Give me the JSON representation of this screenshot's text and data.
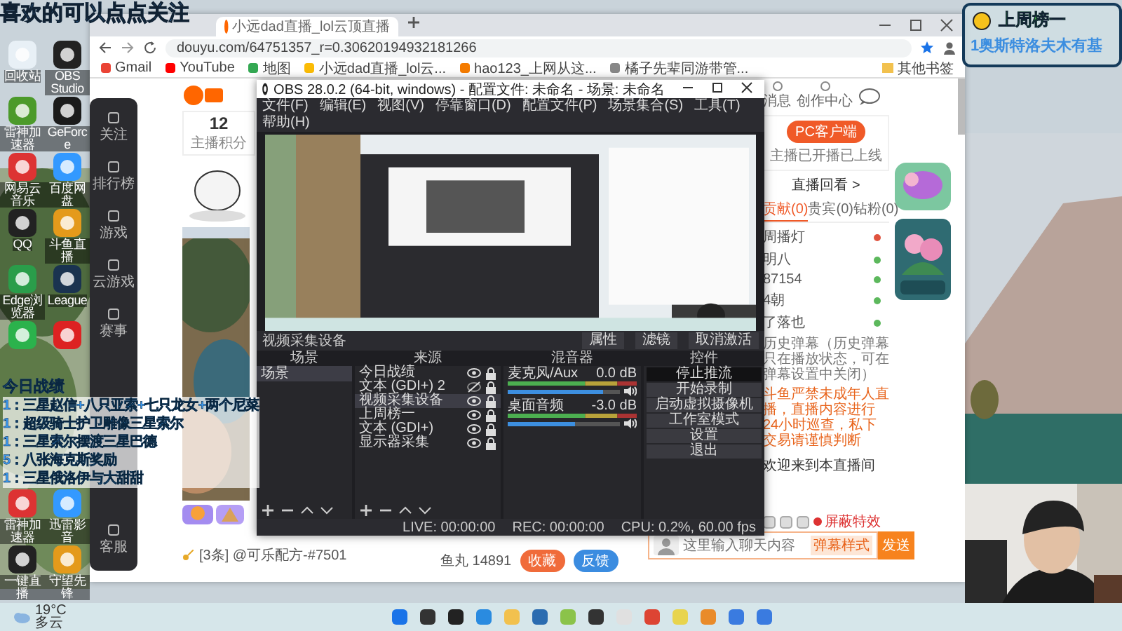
{
  "overlay": {
    "follow_text": "喜欢的可以点点关注",
    "rank_title": "上周榜一",
    "rank_name": "1奥斯特洛夫木有基",
    "record_title": "今日战绩",
    "record_lines": [
      "1：三星赵信+八只亚索+七只龙女+两个尼菜",
      "1：超级骑士护卫雕像三星索尔",
      "1：三星索尔摆渡三星巴德",
      "5：八张海克斯奖励",
      "1：三星俄洛伊与大甜甜"
    ]
  },
  "desktop_icons_top": [
    {
      "kind": "app",
      "label": "回收站"
    },
    {
      "kind": "app",
      "label": "OBS Studio"
    },
    {
      "kind": "app",
      "label": "雷神加速器"
    },
    {
      "kind": "app",
      "label": "GeForce"
    },
    {
      "kind": "app",
      "label": "网易云音乐"
    },
    {
      "kind": "app",
      "label": "百度网盘"
    },
    {
      "kind": "app",
      "label": "QQ"
    },
    {
      "kind": "app",
      "label": "斗鱼直播"
    },
    {
      "kind": "app",
      "label": "Edge浏览器"
    },
    {
      "kind": "app",
      "label": "League"
    },
    {
      "kind": "app"
    },
    {
      "kind": "app"
    }
  ],
  "desktop_icons_bottom": [
    {
      "kind": "app",
      "label": "雷神加速器"
    },
    {
      "kind": "app",
      "label": "迅雷影音"
    },
    {
      "kind": "app",
      "label": "一键直播"
    },
    {
      "kind": "app",
      "label": "守望先锋"
    }
  ],
  "browser": {
    "tab_title": "小远dad直播_lol云顶直播",
    "url": "douyu.com/64751357_r=0.30620194932181266",
    "bookmarks": [
      {
        "label": "Gmail"
      },
      {
        "label": "YouTube"
      },
      {
        "label": "地图"
      },
      {
        "label": "小远dad直播_lol云..."
      },
      {
        "label": "hao123_上网从这..."
      },
      {
        "label": "橘子先辈同游带管..."
      }
    ],
    "other_bookmarks": "其他书签",
    "sidebar": [
      {
        "label": "关注"
      },
      {
        "label": "排行榜"
      },
      {
        "label": "游戏"
      },
      {
        "label": "云游戏"
      },
      {
        "label": "赛事"
      },
      {
        "label": "客服"
      }
    ],
    "score": {
      "value": "12",
      "label": "主播积分"
    },
    "chat_line": "[3条] @可乐配方-#7501",
    "fish": "鱼丸 14891",
    "collect": "收藏",
    "feedback": "反馈",
    "nav": [
      {
        "label": "消息"
      },
      {
        "label": "创作中心"
      }
    ],
    "pc_client": "PC客户端",
    "pc_note": "主播已开播已上线",
    "replay": "直播回看 >",
    "panel_tabs": [
      {
        "label": "贡献(0)",
        "selected": true
      },
      {
        "label": "贵宾(0)",
        "selected": false
      },
      {
        "label": "钻粉(0)",
        "selected": false
      }
    ],
    "ranks": [
      {
        "name": "周播灯",
        "color": "#e0533f"
      },
      {
        "name": "明八",
        "color": "#5cb85c"
      },
      {
        "name": "87154",
        "color": "#5cb85c"
      },
      {
        "name": "4朝",
        "color": "#5cb85c"
      },
      {
        "name": "了落也",
        "color": "#5cb85c"
      }
    ],
    "history_note": "历史弹幕（历史弹幕只在播放状态，可在弹幕设置中关闭）",
    "rules_note": "斗鱼严禁未成年人直播，直播内容进行24小时巡查，私下交易请谨慎判断",
    "welcome": "欢迎来到本直播间",
    "block_effects": "屏蔽特效",
    "chat_placeholder": "这里输入聊天内容",
    "danmu_style": "弹幕样式",
    "send": "发送"
  },
  "obs": {
    "title": "OBS 28.0.2 (64-bit, windows) - 配置文件: 未命名 - 场景: 未命名",
    "menu": [
      "文件(F)",
      "编辑(E)",
      "视图(V)",
      "停靠窗口(D)",
      "配置文件(P)",
      "场景集合(S)",
      "工具(T)",
      "帮助(H)"
    ],
    "source_name": "视频采集设备",
    "source_buttons": [
      "属性",
      "滤镜",
      "取消激活"
    ],
    "dock_titles": [
      "场景",
      "来源",
      "混音器",
      "控件"
    ],
    "scenes": [
      {
        "name": "场景",
        "selected": true
      }
    ],
    "sources": [
      {
        "name": "今日战绩",
        "visible": true,
        "selected": false
      },
      {
        "name": "文本 (GDI+) 2",
        "visible": false,
        "selected": false
      },
      {
        "name": "视频采集设备",
        "visible": true,
        "selected": true
      },
      {
        "name": "上周榜一",
        "visible": true,
        "selected": false
      },
      {
        "name": "文本 (GDI+)",
        "visible": true,
        "selected": false
      },
      {
        "name": "显示器采集",
        "visible": true,
        "selected": false
      }
    ],
    "mixer": [
      {
        "name": "麦克风/Aux",
        "reading": "0.0 dB",
        "level": 0.85
      },
      {
        "name": "桌面音频",
        "reading": "-3.0 dB",
        "level": 0.6
      }
    ],
    "controls": [
      {
        "label": "停止推流",
        "selected": true
      },
      {
        "label": "开始录制",
        "selected": false
      },
      {
        "label": "启动虚拟摄像机",
        "selected": false
      },
      {
        "label": "工作室模式",
        "selected": false
      },
      {
        "label": "设置",
        "selected": false
      },
      {
        "label": "退出",
        "selected": false
      }
    ],
    "status": [
      "LIVE: 00:00:00",
      "REC: 00:00:00",
      "CPU: 0.2%, 60.00 fps"
    ]
  },
  "taskbar": {
    "temperature": "19°C",
    "weather": "多云"
  }
}
